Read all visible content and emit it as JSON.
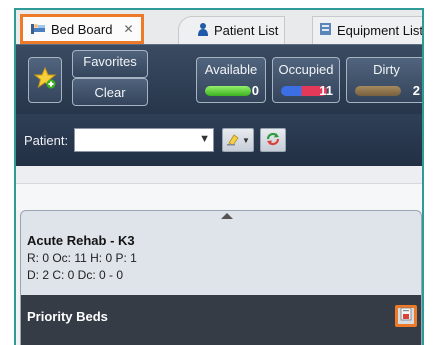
{
  "tabs": [
    {
      "label": "Bed Board",
      "close": "✕",
      "icon": "bed-board-icon",
      "active": true
    },
    {
      "label": "Patient List",
      "icon": "patient-icon",
      "active": false
    },
    {
      "label": "Equipment List",
      "icon": "equipment-icon",
      "active": false
    }
  ],
  "toolbar": {
    "favorites_label": "Favorites",
    "clear_label": "Clear",
    "statuses": [
      {
        "label": "Available",
        "count": "0",
        "color": "#3cb01f"
      },
      {
        "label": "Occupied",
        "count": "11",
        "colors": [
          "#3b6fe3",
          "#e43958"
        ]
      },
      {
        "label": "Dirty",
        "count": "2",
        "color": "#75603f"
      }
    ]
  },
  "filter": {
    "patient_label": "Patient:",
    "patient_value": ""
  },
  "unit": {
    "name": "Acute Rehab - K3",
    "line1": "R: 0 Oc: 11 H: 0 P: 1",
    "line2": "D: 2 C: 0 Dc: 0 - 0"
  },
  "priority": {
    "label": "Priority Beds"
  },
  "colors": {
    "highlight": "#ec7a29",
    "toolbar_dark": "#27364a",
    "frame": "#2f9a96"
  }
}
